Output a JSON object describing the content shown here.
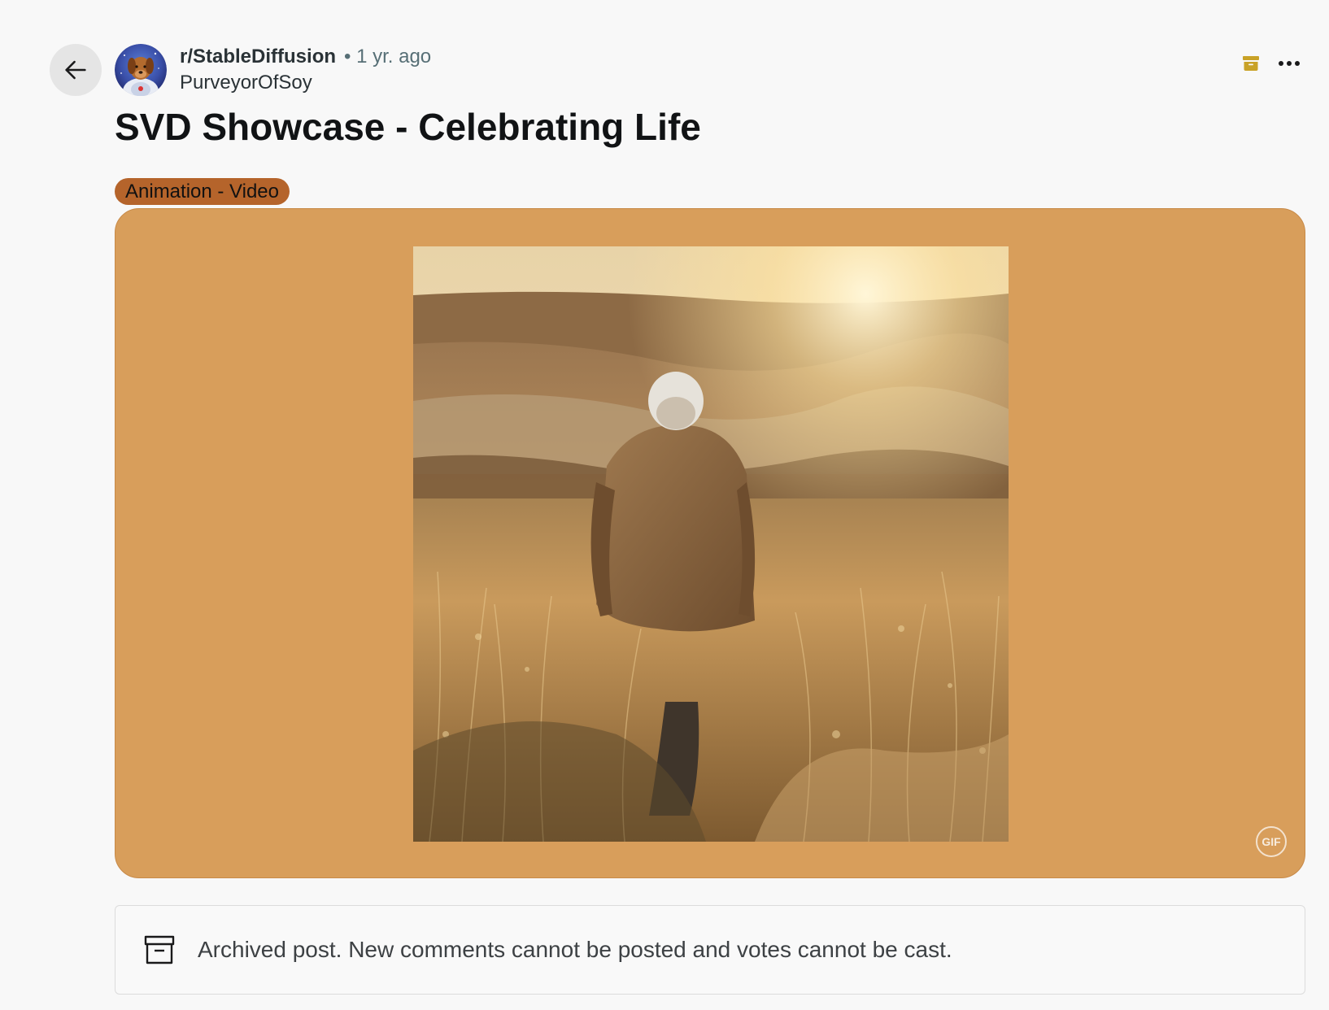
{
  "header": {
    "back_icon": "arrow-left-icon",
    "subreddit": "r/StableDiffusion",
    "time_ago": "• 1 yr. ago",
    "author": "PurveyorOfSoy",
    "archive_icon": "archive-icon",
    "more_icon": "more-options-icon",
    "archive_icon_color": "#c9a227"
  },
  "post": {
    "title": "SVD Showcase - Celebrating Life",
    "flair": "Animation - Video",
    "flair_color": "#b5642b",
    "media_background": "#d89e5b",
    "media_badge": "GIF"
  },
  "archive_notice": {
    "icon": "archive-box-icon",
    "text": "Archived post. New comments cannot be posted and votes cannot be cast."
  }
}
